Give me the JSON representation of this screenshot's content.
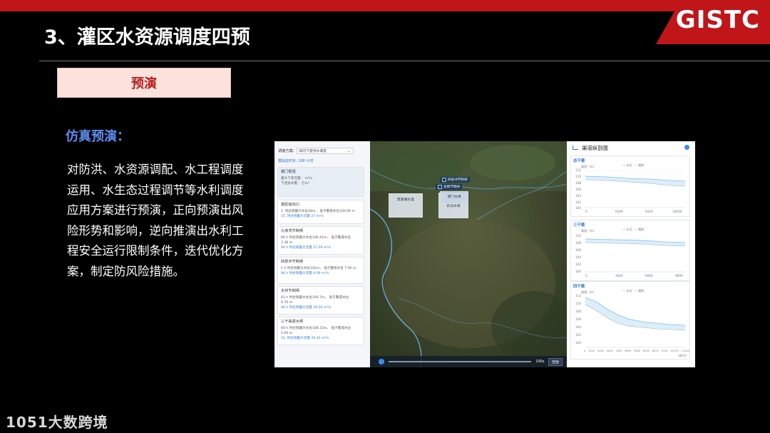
{
  "header": {
    "title": "3、灌区水资源调度四预",
    "logo": "GISTC"
  },
  "tag": {
    "label": "预演"
  },
  "section": {
    "subtitle": "仿真预演：",
    "paragraph": "对防洪、水资源调配、水工程调度运用、水生态过程调节等水利调度应用方案进行预演，正向预演出风险形势和影响，逆向推演出水利工程安全运行限制条件，迭代优化方案，制定防风险措施。"
  },
  "screenshot": {
    "left_panel": {
      "scheme_label": "调度方案:",
      "scheme_value": "四闫下游洪水调度",
      "sim_label": "模拟总时长:",
      "sim_value": "168 小时",
      "cards": [
        {
          "title": "摄门枢纽",
          "lines": [
            "最大下泄流量：  m³/s",
            "下泄总水量：  亿m³"
          ]
        },
        {
          "title": "骆驼垴出口",
          "lines": [
            "1. 时达到最大水位28m，  低于警戒水位100.00 m",
            "15. 时达到最大流量 27 m³/s"
          ]
        },
        {
          "title": "九家湾节制闸",
          "lines": [
            "60 h  时达到最大水位106.41m，  低于警戒水位",
            "2.38 m",
            "96 h  时达到最大流量 27.29 m³/s"
          ]
        },
        {
          "title": "四泉冲节制闸",
          "lines": [
            "1 h  时达到最大水位102m，  低于警戒水位 7.00 m",
            "84 h  时达到最大流量 9.09 m³/s"
          ]
        },
        {
          "title": "东桥节制闸",
          "lines": [
            "41 h  时达到最大水位100.7m，  高于警戒水位",
            "0.70 m",
            "96 h  时达到最大流量 39.56 m³/s"
          ]
        },
        {
          "title": "三干渠退水闸",
          "lines": [
            "60 h  时达到最大水位108.15m，  低于警戒水位",
            "2.00 m",
            "10. 时达到最大流量 20.42 m³/s"
          ]
        }
      ]
    },
    "map": {
      "badges": [
        "四泉冲节制闸",
        "龙窝节制闸"
      ],
      "popups": [
        "莫家嘴水渠",
        "白马水闸",
        "谭门水闸"
      ],
      "timeline_speed": "100x",
      "timeline_button": "回放"
    },
    "right_panel": {
      "title": "渠道纵剖面",
      "legend_water": "— 水位",
      "legend_bottom": "— 渠底",
      "y_unit": "高程（m）",
      "x_unit": "(桩号)",
      "panels": [
        {
          "name": "总干渠",
          "yticks": [
            "112",
            "110",
            "108",
            "106",
            "104",
            "102",
            "100"
          ],
          "xticks": [
            "0",
            "6400",
            "6420",
            "18000"
          ]
        },
        {
          "name": "三干渠",
          "yticks": [
            "110",
            "108",
            "106",
            "104",
            "102",
            "100"
          ],
          "xticks": [
            "0",
            "3000",
            "6000",
            "9000"
          ]
        },
        {
          "name": "四干渠",
          "yticks": [
            "112",
            "110",
            "108",
            "106",
            "104",
            "102",
            "100"
          ],
          "xticks": [
            "0",
            "1520",
            "2000",
            "5000",
            "7603",
            "8609",
            "9500",
            "8250",
            "8070",
            "9700",
            "10720",
            "11200"
          ]
        }
      ]
    }
  },
  "watermark": "1051大数跨境"
}
